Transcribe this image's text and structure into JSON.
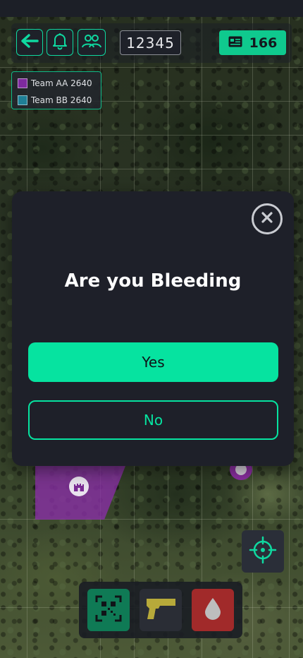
{
  "header": {
    "back_icon": "arrow-left-icon",
    "notifications_icon": "bell-icon",
    "team_icon": "users-icon",
    "player_id": "12345",
    "score_icon": "id-card-icon",
    "score": "166"
  },
  "legend": {
    "items": [
      {
        "label": "Team AA 2640",
        "color": "#7e2a9e"
      },
      {
        "label": "Team BB 2640",
        "color": "#1f7f96"
      }
    ]
  },
  "dialog": {
    "title": "Are you Bleeding",
    "yes_label": "Yes",
    "no_label": "No",
    "close_icon": "close-circle-icon"
  },
  "map": {
    "territory_color": "#7e2a9e",
    "castle_icon": "castle-icon",
    "marker_icon": "map-pin-icon",
    "locate_icon": "crosshair-icon"
  },
  "actions": {
    "scan_icon": "qr-scan-icon",
    "weapon_icon": "pistol-icon",
    "bleed_icon": "blood-drop-icon",
    "colors": {
      "scan": "#0f7a55",
      "weapon": "#2a2d35",
      "bleed": "#a12a2a"
    }
  }
}
